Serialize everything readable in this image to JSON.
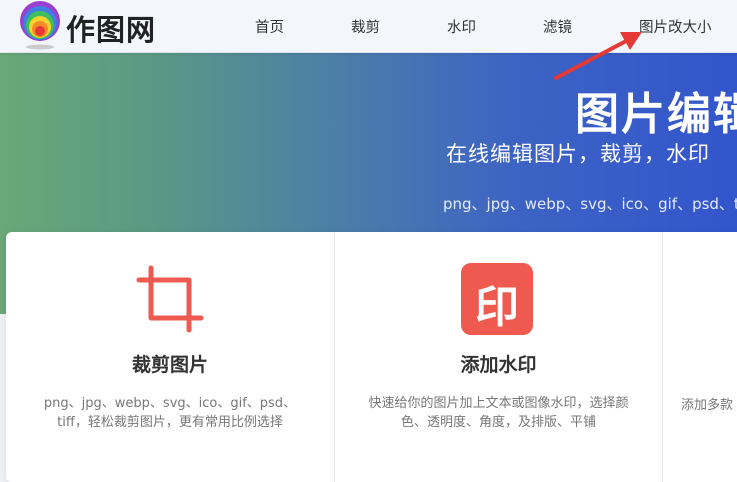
{
  "logo": {
    "text": "作图网"
  },
  "nav": {
    "items": [
      "首页",
      "裁剪",
      "水印",
      "滤镜",
      "图片改大小"
    ]
  },
  "hero": {
    "title": "图片编辑",
    "subtitle": "在线编辑图片，裁剪，水印",
    "formats": "png、jpg、webp、svg、ico、gif、psd、ti"
  },
  "cards": [
    {
      "title": "裁剪图片",
      "icon": "crop-icon",
      "description": "png、jpg、webp、svg、ico、gif、psd、tiff，轻松裁剪图片，更有常用比例选择"
    },
    {
      "title": "添加水印",
      "icon": "watermark-icon",
      "icon_text": "印",
      "description": "快速给你的图片加上文本或图像水印，选择颜色、透明度、角度，及排版、平铺"
    },
    {
      "title": "",
      "description": "添加多款"
    }
  ],
  "colors": {
    "accent_red": "#ee5a4f",
    "arrow_red": "#e53935",
    "hero_left": "#6aa877",
    "hero_right": "#3355cc"
  }
}
